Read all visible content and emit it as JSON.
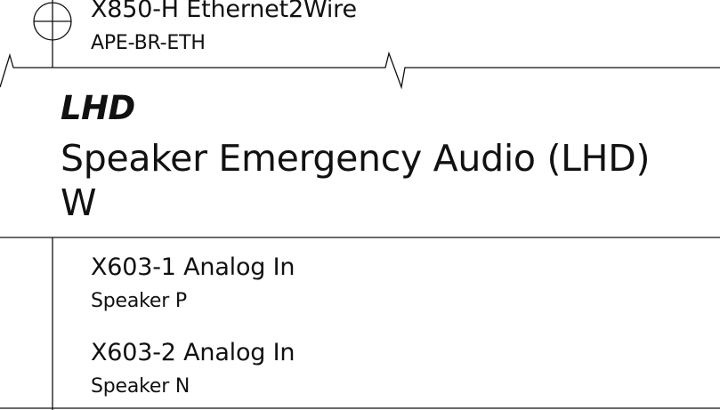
{
  "top_connector": {
    "name": "X850-H Ethernet2Wire",
    "signal": "APE-BR-ETH"
  },
  "device": {
    "code": "LHD",
    "title_line1": "Speaker Emergency Audio (LHD)",
    "title_line2": "W"
  },
  "pins": [
    {
      "name": "X603-1 Analog In",
      "signal": "Speaker P"
    },
    {
      "name": "X603-2 Analog In",
      "signal": "Speaker N"
    }
  ]
}
